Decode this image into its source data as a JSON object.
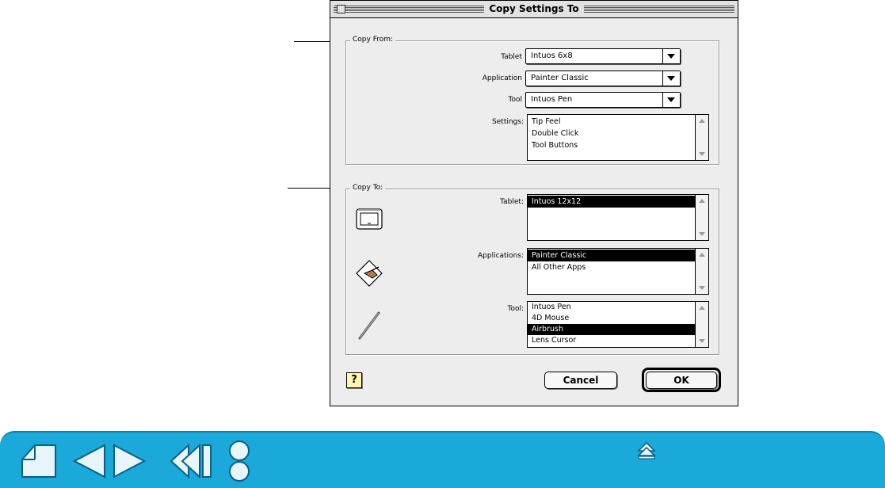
{
  "dialog": {
    "title": "Copy Settings To",
    "copy_from": {
      "group_label": "Copy From:",
      "tablet_label": "Tablet",
      "tablet_value": "Intuos 6x8",
      "application_label": "Application",
      "application_value": "Painter Classic",
      "tool_label": "Tool",
      "tool_value": "Intuos Pen",
      "settings_label": "Settings:",
      "settings_items": [
        "Tip Feel",
        "Double Click",
        "Tool Buttons"
      ]
    },
    "copy_to": {
      "group_label": "Copy To:",
      "tablet_label": "Tablet:",
      "tablet_items": [
        "Intuos 12x12"
      ],
      "applications_label": "Applications:",
      "applications_items": [
        "Painter Classic",
        "All Other Apps"
      ],
      "tool_label": "Tool:",
      "tool_items": [
        "Intuos Pen",
        "4D Mouse",
        "Airbrush",
        "Lens Cursor"
      ],
      "icons": [
        "tablet-icon",
        "application-icon",
        "pen-icon"
      ]
    },
    "buttons": {
      "help": "?",
      "cancel": "Cancel",
      "ok": "OK"
    }
  },
  "navbar": {
    "color": "#1aa9d9",
    "icons": [
      "home-icon",
      "previous-page-icon",
      "next-page-icon",
      "back-icon",
      "contents-icon",
      "top-icon"
    ]
  }
}
